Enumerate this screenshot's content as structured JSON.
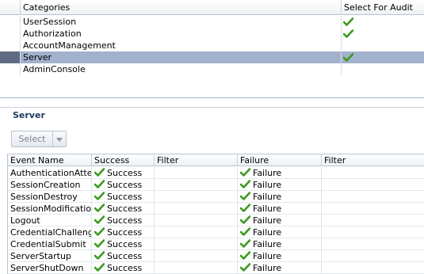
{
  "categories_table": {
    "headers": {
      "categories": "Categories",
      "select_for_audit": "Select For Audit"
    },
    "rows": [
      {
        "name": "UserSession",
        "audit": true,
        "selected": false
      },
      {
        "name": "Authorization",
        "audit": true,
        "selected": false
      },
      {
        "name": "AccountManagement",
        "audit": false,
        "selected": false
      },
      {
        "name": "Server",
        "audit": true,
        "selected": true
      },
      {
        "name": "AdminConsole",
        "audit": false,
        "selected": false
      }
    ]
  },
  "section": {
    "title": "Server"
  },
  "toolbar": {
    "select_label": "Select"
  },
  "events_table": {
    "headers": {
      "event_name": "Event Name",
      "success": "Success",
      "filter1": "Filter",
      "failure": "Failure",
      "filter2": "Filter"
    },
    "rows": [
      {
        "event": "AuthenticationAttempt",
        "success": "Success",
        "failure": "Failure"
      },
      {
        "event": "SessionCreation",
        "success": "Success",
        "failure": "Failure"
      },
      {
        "event": "SessionDestroy",
        "success": "Success",
        "failure": "Failure"
      },
      {
        "event": "SessionModification",
        "success": "Success",
        "failure": "Failure"
      },
      {
        "event": "Logout",
        "success": "Success",
        "failure": "Failure"
      },
      {
        "event": "CredentialChallenge",
        "success": "Success",
        "failure": "Failure"
      },
      {
        "event": "CredentialSubmit",
        "success": "Success",
        "failure": "Failure"
      },
      {
        "event": "ServerStartup",
        "success": "Success",
        "failure": "Failure"
      },
      {
        "event": "ServerShutDown",
        "success": "Success",
        "failure": "Failure"
      }
    ]
  },
  "colors": {
    "selected_row": "#a2b1cc",
    "check_green": "#3a9a1f",
    "section_title": "#1f3a5f"
  },
  "icons": {
    "check": "checkmark-icon",
    "dropdown": "chevron-down-icon"
  }
}
